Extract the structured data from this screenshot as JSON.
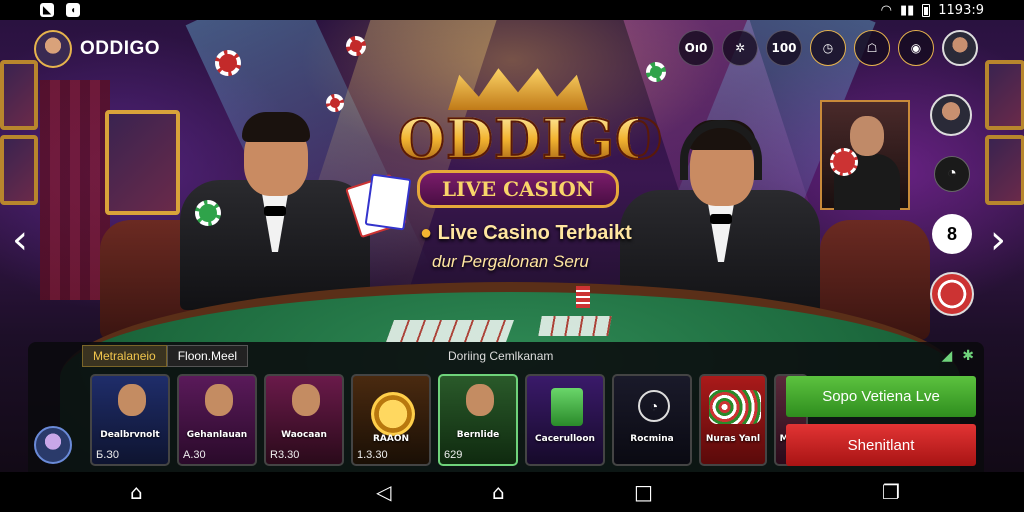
{
  "status_bar": {
    "time": "1193:9",
    "left_icons": [
      "notification-icon",
      "app-icon"
    ],
    "right_icons": [
      "wifi-icon",
      "signal-icon",
      "battery-icon"
    ]
  },
  "header": {
    "brand": "ODDIGO",
    "icons": [
      {
        "name": "balance-counter",
        "label": "Oı0"
      },
      {
        "name": "tools-icon",
        "label": "✲"
      },
      {
        "name": "counter-icon",
        "label": "100"
      },
      {
        "name": "clock-icon",
        "label": "◷"
      },
      {
        "name": "chat-icon",
        "label": "☖"
      },
      {
        "name": "vip-icon",
        "label": "◉"
      },
      {
        "name": "profile-avatar",
        "label": ""
      }
    ]
  },
  "hero": {
    "logo_title": "ODDIGO",
    "logo_subtitle": "LIVE CASION",
    "tagline": "Live Casino Terbaikt",
    "tagline_sub": "dur Pergalonan Seru"
  },
  "side": {
    "widget_label": "8"
  },
  "panel": {
    "tabs": [
      "Metralaneio",
      "Floon.Meel"
    ],
    "title": "Doriing Cemlkanam"
  },
  "games": [
    {
      "name": "Dealbrvnolt",
      "price": "Б.З0",
      "art": "#1f2d6a"
    },
    {
      "name": "Gehanlauan",
      "price": "A.30",
      "art": "#5a1a5a"
    },
    {
      "name": "Waocaan",
      "price": "R3.30",
      "art": "#6a1a4a"
    },
    {
      "name": "RAAON",
      "price": "1.3.30",
      "art": "#4a2a10"
    },
    {
      "name": "Bernlide",
      "price": "629",
      "art": "#2a5a2a"
    },
    {
      "name": "Cacerulloon",
      "price": "",
      "art": "#3a1a6a"
    },
    {
      "name": "Rocmina",
      "price": "",
      "art": "#1a1a2a"
    },
    {
      "name": "Nuras Yanl",
      "price": "",
      "art": "#aa1a1a"
    },
    {
      "name": "Miro",
      "price": "",
      "art": "#5a2a3a"
    }
  ],
  "buttons": {
    "live": "Sopo Vetiena Lve",
    "red": "Shenitlant"
  },
  "colors": {
    "accent_gold": "#f2b431",
    "green_button": "#4fb535",
    "red_button": "#d42424"
  }
}
